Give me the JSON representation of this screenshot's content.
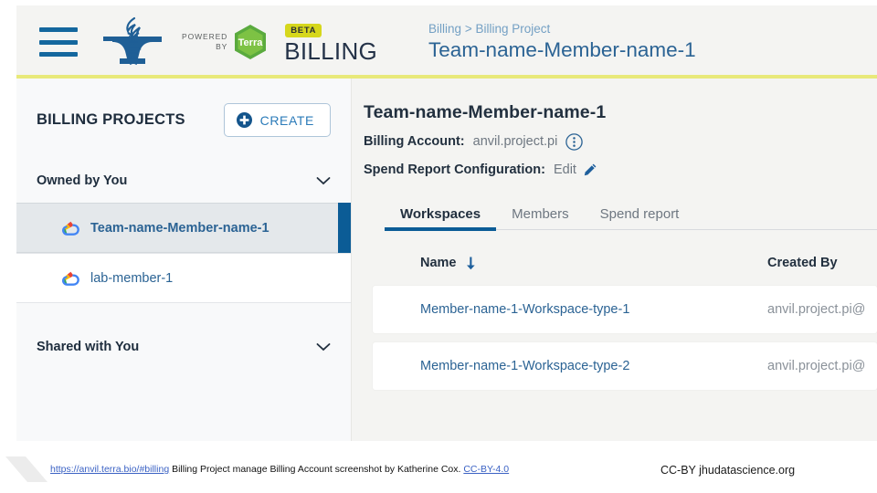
{
  "header": {
    "menu_icon": "hamburger-menu-icon",
    "logo_icon": "anvil-dna-logo-icon",
    "powered_by_line1": "POWERED",
    "powered_by_line2": "BY",
    "terra_badge": "Terra",
    "beta_badge": "BETA",
    "product_name": "BILLING",
    "breadcrumb": "Billing > Billing Project",
    "breadcrumb_title": "Team-name-Member-name-1",
    "accent_color": "#e8e97a"
  },
  "sidebar": {
    "title": "BILLING PROJECTS",
    "create_button": "CREATE",
    "groups": [
      {
        "label": "Owned by You",
        "expanded": true,
        "items": [
          {
            "label": "Team-name-Member-name-1",
            "icon": "google-cloud-icon",
            "selected": true
          },
          {
            "label": "lab-member-1",
            "icon": "google-cloud-icon",
            "selected": false
          }
        ]
      },
      {
        "label": "Shared with You",
        "expanded": true,
        "items": []
      }
    ],
    "selected_accent": "#0b5c96"
  },
  "main": {
    "title": "Team-name-Member-name-1",
    "billing_account_label": "Billing Account:",
    "billing_account_value": "anvil.project.pi",
    "kebab_icon": "more-options-circle-icon",
    "spend_report_label": "Spend Report Configuration:",
    "spend_report_action": "Edit",
    "pencil_icon": "edit-pencil-icon",
    "highlight_color": "#f59310",
    "tabs": [
      {
        "label": "Workspaces",
        "active": true
      },
      {
        "label": "Members",
        "active": false
      },
      {
        "label": "Spend report",
        "active": false
      }
    ],
    "table": {
      "columns": [
        {
          "label": "Name",
          "sort_icon": "sort-descending-arrow-icon"
        },
        {
          "label": "Created By",
          "sort_icon": null
        }
      ],
      "rows": [
        {
          "name": "Member-name-1-Workspace-type-1",
          "created_by": "anvil.project.pi@"
        },
        {
          "name": "Member-name-1-Workspace-type-2",
          "created_by": "anvil.project.pi@"
        }
      ]
    }
  },
  "footer": {
    "source_url": "https://anvil.terra.bio/#billing",
    "caption_text": " Billing Project manage Billing Account screenshot by Katherine Cox. ",
    "license_link": "CC-BY-4.0",
    "credit": "CC-BY  jhudatascience.org"
  }
}
